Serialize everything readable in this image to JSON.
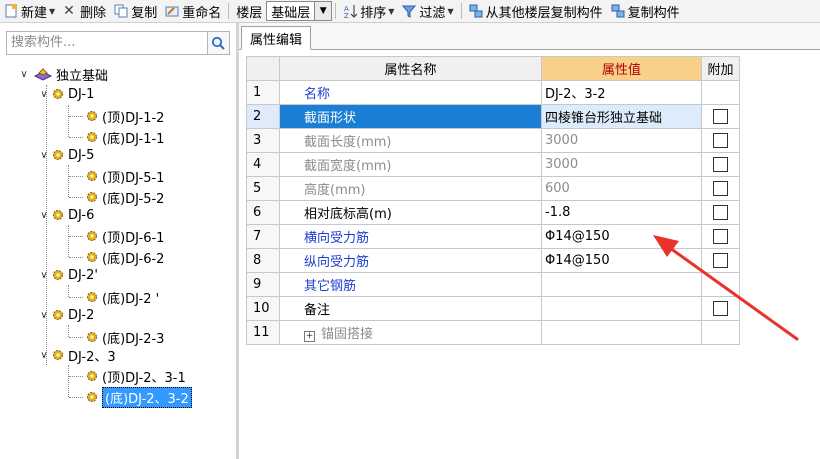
{
  "toolbar": {
    "new_label": "新建",
    "delete_label": "删除",
    "copy_label": "复制",
    "rename_label": "重命名",
    "floor_label": "楼层",
    "floor_value": "基础层",
    "sort_label": "排序",
    "filter_label": "过滤",
    "copy_from_floor_label": "从其他楼层复制构件",
    "copy_component_label": "复制构件"
  },
  "search": {
    "placeholder": "搜索构件..."
  },
  "tree": {
    "root": "独立基础",
    "groups": [
      {
        "label": "DJ-1",
        "children": [
          "(顶)DJ-1-2",
          "(底)DJ-1-1"
        ]
      },
      {
        "label": "DJ-5",
        "children": [
          "(顶)DJ-5-1",
          "(底)DJ-5-2"
        ]
      },
      {
        "label": "DJ-6",
        "children": [
          "(顶)DJ-6-1",
          "(底)DJ-6-2"
        ]
      },
      {
        "label": "DJ-2'",
        "children": [
          "(底)DJ-2 '"
        ]
      },
      {
        "label": "DJ-2",
        "children": [
          "(底)DJ-2-3"
        ]
      },
      {
        "label": "DJ-2、3",
        "children": [
          "(顶)DJ-2、3-1",
          "(底)DJ-2、3-2"
        ]
      }
    ]
  },
  "tab": {
    "label": "属性编辑"
  },
  "grid": {
    "headers": {
      "name": "属性名称",
      "value": "属性值",
      "add": "附加"
    },
    "rows": [
      {
        "no": "1",
        "name": "名称",
        "value": "DJ-2、3-2",
        "style": "blue",
        "checkbox": false
      },
      {
        "no": "2",
        "name": "截面形状",
        "value": "四棱锥台形独立基础",
        "style": "selected",
        "checkbox": true
      },
      {
        "no": "3",
        "name": "截面长度(mm)",
        "value": "3000",
        "style": "gray",
        "checkbox": true
      },
      {
        "no": "4",
        "name": "截面宽度(mm)",
        "value": "3000",
        "style": "gray",
        "checkbox": true
      },
      {
        "no": "5",
        "name": "高度(mm)",
        "value": "600",
        "style": "gray",
        "checkbox": true
      },
      {
        "no": "6",
        "name": "相对底标高(m)",
        "value": "-1.8",
        "style": "normal",
        "checkbox": true
      },
      {
        "no": "7",
        "name": "横向受力筋",
        "value": "Φ14@150",
        "style": "blue",
        "checkbox": true
      },
      {
        "no": "8",
        "name": "纵向受力筋",
        "value": "Φ14@150",
        "style": "blue",
        "checkbox": true
      },
      {
        "no": "9",
        "name": "其它钢筋",
        "value": "",
        "style": "blue",
        "checkbox": false
      },
      {
        "no": "10",
        "name": "备注",
        "value": "",
        "style": "normal",
        "checkbox": true
      },
      {
        "no": "11",
        "name": "锚固搭接",
        "value": "",
        "style": "gray-expand",
        "checkbox": false
      }
    ]
  },
  "colors": {
    "accent": "#1a7fd4",
    "annotation_arrow": "#e8322a",
    "value_header": "#f9d08a"
  }
}
